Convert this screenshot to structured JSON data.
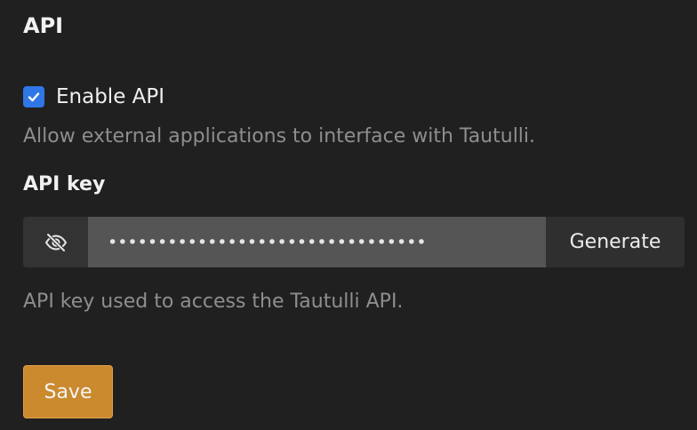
{
  "section": {
    "title": "API"
  },
  "enable_api": {
    "label": "Enable API",
    "checked": true,
    "description": "Allow external applications to interface with Tautulli."
  },
  "api_key": {
    "label": "API key",
    "masked_value": "••••••••••••••••••••••••••••••••",
    "toggle_icon": "eye-slash-icon",
    "generate_label": "Generate",
    "description": "API key used to access the Tautulli API."
  },
  "actions": {
    "save_label": "Save"
  },
  "colors": {
    "background": "#202020",
    "checkbox": "#2f77e6",
    "save_button": "#cb8a2e",
    "input_field": "#555555"
  }
}
